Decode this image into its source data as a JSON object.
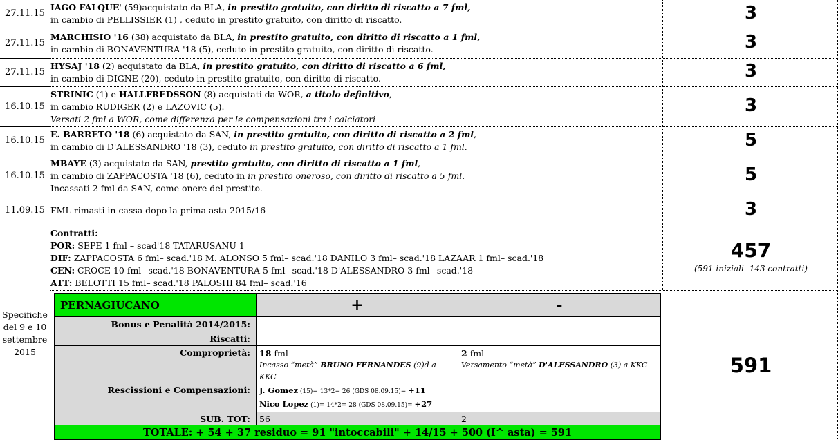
{
  "rows": [
    {
      "date": "27.11.15",
      "line1": {
        "name": "IAGO FALQUE",
        "mid": "' (59)acquistato da BLA, ",
        "terms": " in prestito gratuito, con diritto di riscatto a 7 fml,"
      },
      "line2": "in cambio di PELLISSIER (1) , ceduto in prestito gratuito, con diritto di riscatto.",
      "value": "3"
    },
    {
      "date": "27.11.15",
      "line1": {
        "name": "MARCHISIO '16",
        "mid": " (38) acquistato da BLA, ",
        "terms": " in prestito gratuito, con diritto di riscatto a 1 fml,"
      },
      "line2": "in cambio di BONAVENTURA '18 (5), ceduto in prestito gratuito, con diritto di riscatto.",
      "value": "3"
    },
    {
      "date": "27.11.15",
      "line1": {
        "name": "HYSAJ '18",
        "mid": " (2) acquistato da BLA, ",
        "terms": " in prestito gratuito, con diritto di riscatto a 6 fml,"
      },
      "line2": "in cambio di DIGNE (20), ceduto in prestito gratuito, con diritto di riscatto.",
      "value": "3"
    },
    {
      "date": "16.10.15",
      "line1": {
        "name": "STRINIC",
        "mid2": " (1) e ",
        "name2": "HALLFREDSSON",
        "mid": " (8) acquistati da WOR, ",
        "terms": "a titolo definitivo",
        "tail": ","
      },
      "line2": "in cambio RUDIGER (2) e LAZOVIC (5).",
      "line3": "Versati 2 fml a WOR, come differenza per le compensazioni tra i calciatori",
      "value": "3"
    },
    {
      "date": "16.10.15",
      "line1": {
        "name": "E. BARRETO '18",
        "mid": " (6) acquistato da SAN, ",
        "terms": "in prestito gratuito, con diritto di riscatto a 2 fml",
        "tail": ","
      },
      "line2a": "in cambio di D'ALESSANDRO '18 (3), ceduto ",
      "line2b": "in prestito gratuito, con diritto di riscatto a 1 fml.",
      "value": "5"
    },
    {
      "date": "16.10.15",
      "line1": {
        "name": "MBAYE",
        "mid": " (3) acquistato da SAN, ",
        "terms": "prestito gratuito, con diritto di riscatto a 1 fml",
        "tail": ","
      },
      "line2a": "in cambio di ZAPPACOSTA '18 (6), ceduto in ",
      "line2b": "in prestito oneroso, con diritto di riscatto a 5 fml.",
      "line3": "Incassati 2 fml da SAN, come onere del prestito.",
      "value": "5"
    },
    {
      "date": "11.09.15",
      "text": "FML rimasti in cassa dopo la prima asta 2015/16",
      "value": "3"
    }
  ],
  "contratti": {
    "title": "Contratti:",
    "por_label": "POR:",
    "por": " SEPE 1 fml – scad'18  TATARUSANU 1",
    "dif_label": "DIF:",
    "dif": " ZAPPACOSTA 6 fml– scad.'18  M. ALONSO 5 fml– scad.'18  DANILO 3 fml– scad.'18  LAZAAR 1 fml– scad.'18",
    "cen_label": "CEN:",
    "cen": " CROCE 10  fml– scad.'18  BONAVENTURA 5  fml– scad.'18  D'ALESSANDRO 3  fml– scad.'18",
    "att_label": "ATT:",
    "att": " BELOTTI 15  fml– scad.'18  PALOSHI 84  fml– scad.'16",
    "value": "457",
    "note": "(591 iniziali -143 contratti)"
  },
  "specifiche": "Specifiche del 9 e 10 settembre 2015",
  "pernagiucano": {
    "title": "PERNAGIUCANO",
    "plus": "+",
    "minus": "-",
    "bonus_label": "Bonus e Penalità 2014/2015:",
    "riscatti_label": "Riscatti:",
    "compro_label": "Comproprietà:",
    "compro_plus_num": "18",
    "compro_plus_unit": " fml",
    "compro_plus_note_a": "Incasso “metà” ",
    "compro_plus_note_b": "BRUNO FERNANDES",
    "compro_plus_note_c": " (9)d a KKC",
    "compro_minus_num": "2",
    "compro_minus_unit": " fml",
    "compro_minus_note_a": "Versamento “metà” ",
    "compro_minus_note_b": "D'ALESSANDRO",
    "compro_minus_note_c": " (3) a KKC",
    "resc_label": "Rescissioni e Compensazioni:",
    "resc1_name": "J. Gomez",
    "resc1_calc": " (15)= 13*2= 26 (GDS 08.09.15)= ",
    "resc1_val": "+11",
    "resc2_name": "Nico Lopez",
    "resc2_calc": " (1)= 14*2= 28 (GDS 08.09.15)= ",
    "resc2_val": "+27",
    "subtot_label": "SUB. TOT:",
    "subtot_plus": "56",
    "subtot_minus": "2",
    "totale": "TOTALE: + 54 + 37 residuo = 91 \"intoccabili\" + 14/15 + 500 (I^ asta) = 591",
    "value": "591"
  },
  "colors": {
    "green": "#00e600",
    "grey": "#d9d9d9"
  }
}
